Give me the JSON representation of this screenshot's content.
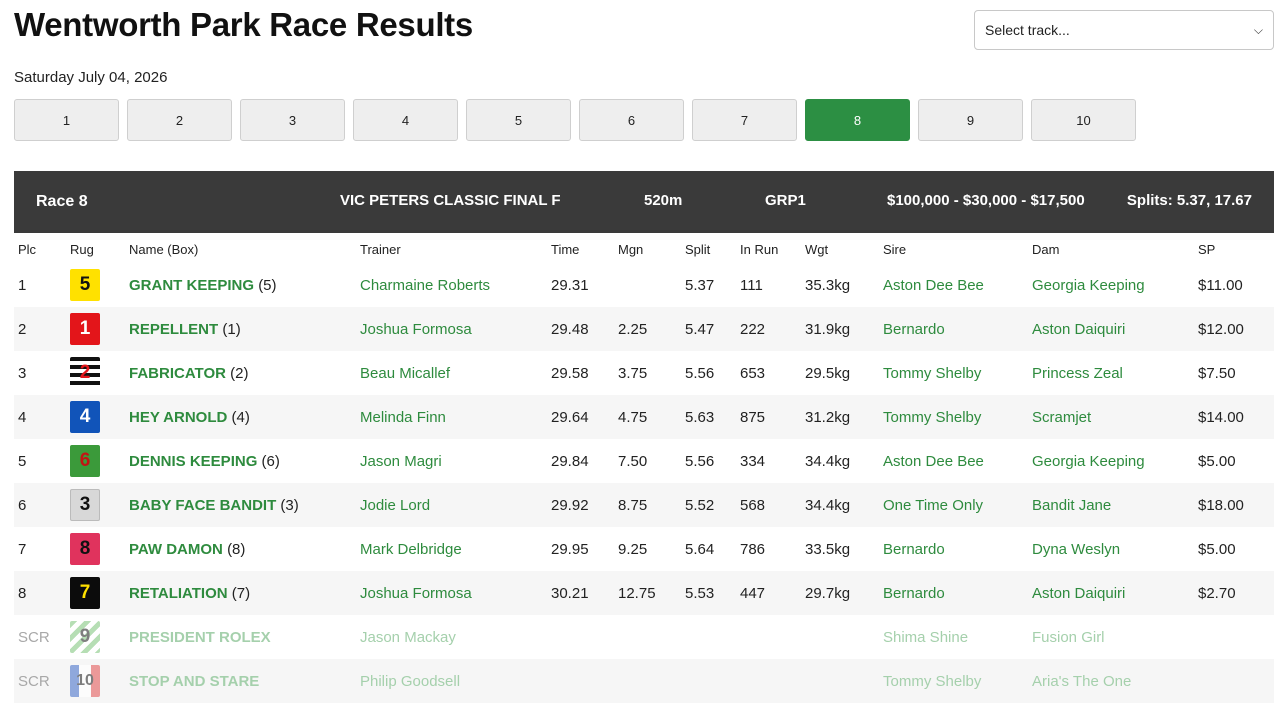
{
  "page": {
    "title": "Wentworth Park Race Results",
    "date": "Saturday July 04, 2026"
  },
  "track_select": {
    "selected": "Select track..."
  },
  "race_tabs": [
    {
      "label": "1",
      "active": false
    },
    {
      "label": "2",
      "active": false
    },
    {
      "label": "3",
      "active": false
    },
    {
      "label": "4",
      "active": false
    },
    {
      "label": "5",
      "active": false
    },
    {
      "label": "6",
      "active": false
    },
    {
      "label": "7",
      "active": false
    },
    {
      "label": "8",
      "active": true
    },
    {
      "label": "9",
      "active": false
    },
    {
      "label": "10",
      "active": false
    }
  ],
  "race": {
    "label": "Race 8",
    "name": "VIC PETERS CLASSIC FINAL F",
    "distance": "520m",
    "grade": "GRP1",
    "prize": "$100,000 - $30,000 - $17,500",
    "splits": "Splits: 5.37, 17.67"
  },
  "columns": {
    "plc": "Plc",
    "rug": "Rug",
    "name": "Name (Box)",
    "trainer": "Trainer",
    "time": "Time",
    "mgn": "Mgn",
    "split": "Split",
    "inrun": "In Run",
    "wgt": "Wgt",
    "sire": "Sire",
    "dam": "Dam",
    "sp": "SP"
  },
  "colors": {
    "accent_green": "#2c8f43",
    "header_bg": "#3a3a3a",
    "link_green": "#2e8b3e"
  },
  "results": [
    {
      "plc": "1",
      "rug": "5",
      "name": "GRANT KEEPING",
      "box": "(5)",
      "trainer": "Charmaine Roberts",
      "time": "29.31",
      "mgn": "",
      "split": "5.37",
      "inrun": "111",
      "wgt": "35.3kg",
      "sire": "Aston Dee Bee",
      "dam": "Georgia Keeping",
      "sp": "$11.00",
      "scr": false
    },
    {
      "plc": "2",
      "rug": "1",
      "name": "REPELLENT",
      "box": "(1)",
      "trainer": "Joshua Formosa",
      "time": "29.48",
      "mgn": "2.25",
      "split": "5.47",
      "inrun": "222",
      "wgt": "31.9kg",
      "sire": "Bernardo",
      "dam": "Aston Daiquiri",
      "sp": "$12.00",
      "scr": false
    },
    {
      "plc": "3",
      "rug": "2",
      "name": "FABRICATOR",
      "box": "(2)",
      "trainer": "Beau Micallef",
      "time": "29.58",
      "mgn": "3.75",
      "split": "5.56",
      "inrun": "653",
      "wgt": "29.5kg",
      "sire": "Tommy Shelby",
      "dam": "Princess Zeal",
      "sp": "$7.50",
      "scr": false
    },
    {
      "plc": "4",
      "rug": "4",
      "name": "HEY ARNOLD",
      "box": "(4)",
      "trainer": "Melinda Finn",
      "time": "29.64",
      "mgn": "4.75",
      "split": "5.63",
      "inrun": "875",
      "wgt": "31.2kg",
      "sire": "Tommy Shelby",
      "dam": "Scramjet",
      "sp": "$14.00",
      "scr": false
    },
    {
      "plc": "5",
      "rug": "6",
      "name": "DENNIS KEEPING",
      "box": "(6)",
      "trainer": "Jason Magri",
      "time": "29.84",
      "mgn": "7.50",
      "split": "5.56",
      "inrun": "334",
      "wgt": "34.4kg",
      "sire": "Aston Dee Bee",
      "dam": "Georgia Keeping",
      "sp": "$5.00",
      "scr": false
    },
    {
      "plc": "6",
      "rug": "3",
      "name": "BABY FACE BANDIT",
      "box": "(3)",
      "trainer": "Jodie Lord",
      "time": "29.92",
      "mgn": "8.75",
      "split": "5.52",
      "inrun": "568",
      "wgt": "34.4kg",
      "sire": "One Time Only",
      "dam": "Bandit Jane",
      "sp": "$18.00",
      "scr": false
    },
    {
      "plc": "7",
      "rug": "8",
      "name": "PAW DAMON",
      "box": "(8)",
      "trainer": "Mark Delbridge",
      "time": "29.95",
      "mgn": "9.25",
      "split": "5.64",
      "inrun": "786",
      "wgt": "33.5kg",
      "sire": "Bernardo",
      "dam": "Dyna Weslyn",
      "sp": "$5.00",
      "scr": false
    },
    {
      "plc": "8",
      "rug": "7",
      "name": "RETALIATION",
      "box": "(7)",
      "trainer": "Joshua Formosa",
      "time": "30.21",
      "mgn": "12.75",
      "split": "5.53",
      "inrun": "447",
      "wgt": "29.7kg",
      "sire": "Bernardo",
      "dam": "Aston Daiquiri",
      "sp": "$2.70",
      "scr": false
    },
    {
      "plc": "SCR",
      "rug": "9",
      "name": "PRESIDENT ROLEX",
      "box": "",
      "trainer": "Jason Mackay",
      "time": "",
      "mgn": "",
      "split": "",
      "inrun": "",
      "wgt": "",
      "sire": "Shima Shine",
      "dam": "Fusion Girl",
      "sp": "",
      "scr": true
    },
    {
      "plc": "SCR",
      "rug": "10",
      "name": "STOP AND STARE",
      "box": "",
      "trainer": "Philip Goodsell",
      "time": "",
      "mgn": "",
      "split": "",
      "inrun": "",
      "wgt": "",
      "sire": "Tommy Shelby",
      "dam": "Aria's The One",
      "sp": "",
      "scr": true
    }
  ]
}
